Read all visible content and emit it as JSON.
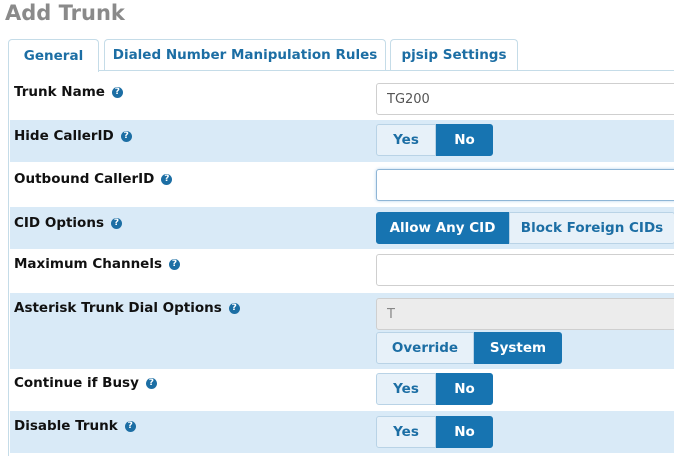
{
  "page": {
    "title": "Add Trunk"
  },
  "tabs": [
    {
      "label": "General",
      "active": true
    },
    {
      "label": "Dialed Number Manipulation Rules",
      "active": false
    },
    {
      "label": "pjsip Settings",
      "active": false
    }
  ],
  "help_icon": "help-circle-icon",
  "fields": {
    "trunk_name": {
      "label": "Trunk Name",
      "value": "TG200"
    },
    "hide_callerid": {
      "label": "Hide CallerID",
      "options": [
        "Yes",
        "No"
      ],
      "selected": "No"
    },
    "outbound_callerid": {
      "label": "Outbound CallerID",
      "value": ""
    },
    "cid_options": {
      "label": "CID Options",
      "options": [
        "Allow Any CID",
        "Block Foreign CIDs"
      ],
      "selected": "Allow Any CID"
    },
    "max_channels": {
      "label": "Maximum Channels",
      "value": ""
    },
    "dial_options": {
      "label": "Asterisk Trunk Dial Options",
      "value": "T",
      "options": [
        "Override",
        "System"
      ],
      "selected": "System"
    },
    "continue_if_busy": {
      "label": "Continue if Busy",
      "options": [
        "Yes",
        "No"
      ],
      "selected": "No"
    },
    "disable_trunk": {
      "label": "Disable Trunk",
      "options": [
        "Yes",
        "No"
      ],
      "selected": "No"
    }
  },
  "colors": {
    "accent": "#1774b1",
    "row_shade": "#d9eaf7",
    "title": "#8a8a8a"
  }
}
